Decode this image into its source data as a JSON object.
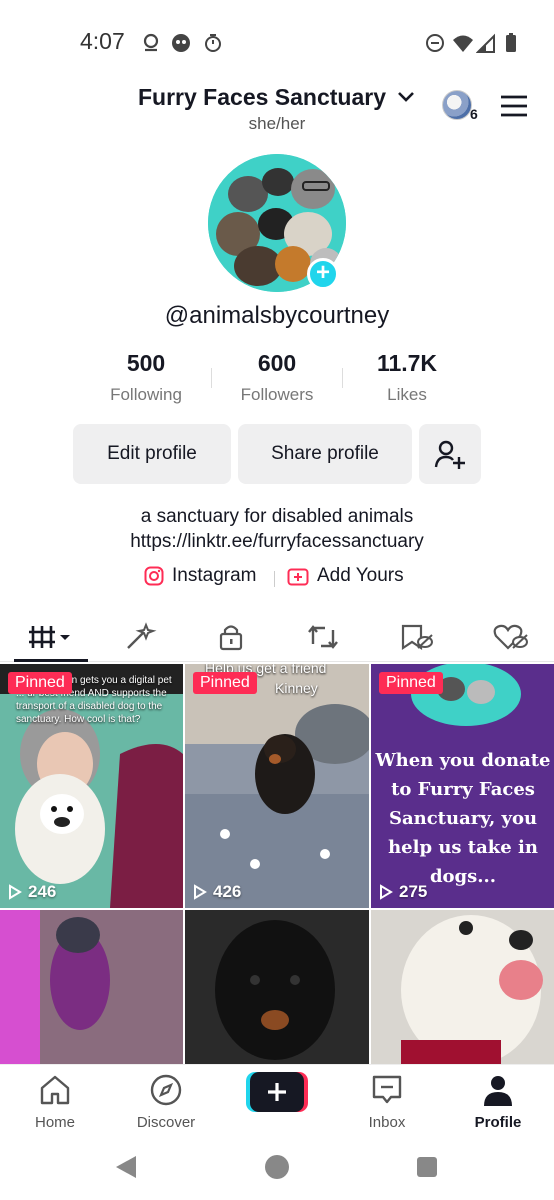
{
  "status_bar": {
    "time": "4:07"
  },
  "header": {
    "account_name": "Furry Faces Sanctuary",
    "pronouns": "she/her",
    "switch_account_count": "6"
  },
  "profile": {
    "username": "@animalsbycourtney",
    "stats": [
      {
        "value": "500",
        "label": "Following"
      },
      {
        "value": "600",
        "label": "Followers"
      },
      {
        "value": "11.7K",
        "label": "Likes"
      }
    ],
    "buttons": {
      "edit": "Edit profile",
      "share": "Share profile"
    },
    "bio_line1": "a sanctuary for disabled animals",
    "bio_line2": "https://linktr.ee/furryfacessanctuary",
    "links": {
      "instagram": "Instagram",
      "add_yours": "Add Yours"
    }
  },
  "grid": {
    "pinned_label": "Pinned",
    "videos": [
      {
        "views": "246",
        "caption": "A $5 donation gets you a digital pet ... ur best friend AND supports the transport of a disabled dog to the sanctuary. How cool is that?"
      },
      {
        "views": "426",
        "caption_line1": "Help us get a friend",
        "caption_line2": "Kinney"
      },
      {
        "views": "275",
        "text": "When you donate to Furry Faces Sanctuary, you help us take in dogs..."
      },
      {},
      {},
      {}
    ]
  },
  "bottom_nav": {
    "home": "Home",
    "discover": "Discover",
    "inbox": "Inbox",
    "profile": "Profile"
  },
  "colors": {
    "accent": "#fe2c55",
    "cyan": "#20d5ec"
  }
}
